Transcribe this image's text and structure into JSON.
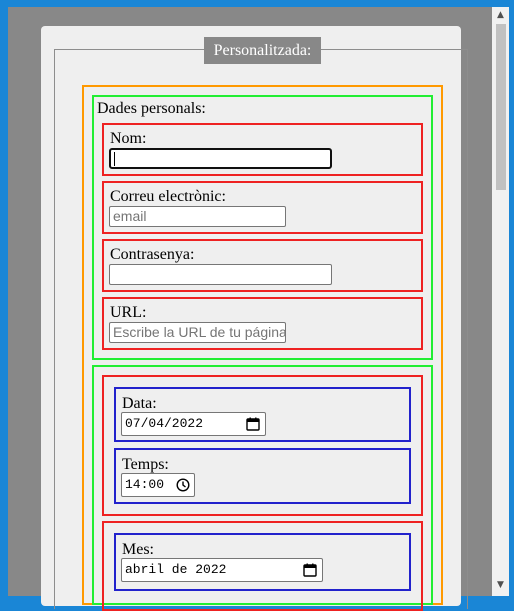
{
  "fieldset": {
    "legend": "Personalitzada:"
  },
  "personal": {
    "title": "Dades personals:",
    "name": {
      "label": "Nom:",
      "value": ""
    },
    "email": {
      "label": "Correu electrònic:",
      "placeholder": "email"
    },
    "password": {
      "label": "Contrasenya:",
      "value": ""
    },
    "url": {
      "label": "URL:",
      "placeholder": "Escribe la URL de tu página"
    }
  },
  "datetime": {
    "date": {
      "label": "Data:",
      "value": "07/04/2022"
    },
    "time": {
      "label": "Temps:",
      "value": "14:00"
    },
    "month": {
      "label": "Mes:",
      "value": "abril de 2022"
    }
  },
  "icons": {
    "calendar": "calendar-icon",
    "clock": "clock-icon",
    "scroll_up": "▲",
    "scroll_down": "▼"
  },
  "colors": {
    "orange_border": "#ff9900",
    "green_border": "#22ee33",
    "red_border": "#ee2222",
    "blue_border": "#2222cc"
  }
}
